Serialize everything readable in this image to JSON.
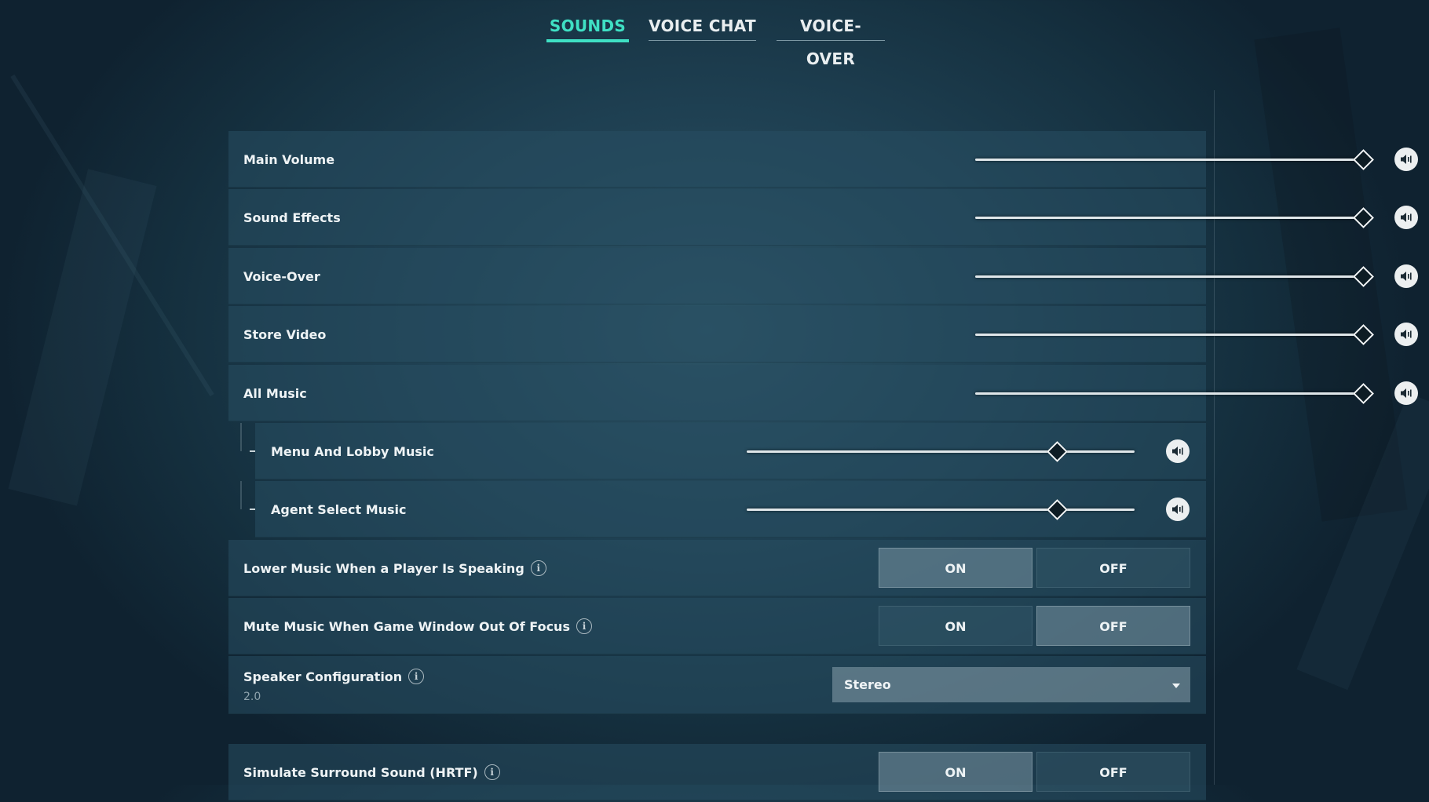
{
  "tabs": [
    {
      "label": "SOUNDS",
      "active": true
    },
    {
      "label": "VOICE CHAT",
      "active": false
    },
    {
      "label": "VOICE-OVER",
      "active": false
    }
  ],
  "colors": {
    "accent": "#3fe0c4"
  },
  "sliders": [
    {
      "label": "Main Volume",
      "value": 1.0
    },
    {
      "label": "Sound Effects",
      "value": 1.0
    },
    {
      "label": "Voice-Over",
      "value": 1.0
    },
    {
      "label": "Store Video",
      "value": 1.0
    },
    {
      "label": "All Music",
      "value": 1.0
    },
    {
      "label": "Menu And Lobby Music",
      "value": 0.8
    },
    {
      "label": "Agent Select Music",
      "value": 0.8
    }
  ],
  "mute_icon": "speaker-icon",
  "toggles": [
    {
      "label": "Lower Music When a Player Is Speaking",
      "on": "ON",
      "off": "OFF",
      "selected": "on"
    },
    {
      "label": "Mute Music When Game Window Out Of Focus",
      "on": "ON",
      "off": "OFF",
      "selected": "off"
    },
    {
      "label": "Simulate Surround Sound (HRTF)",
      "on": "ON",
      "off": "OFF",
      "selected": "on"
    }
  ],
  "speaker_config": {
    "label": "Speaker Configuration",
    "sub_value": "2.0",
    "selected": "Stereo"
  },
  "info_glyph": "i"
}
